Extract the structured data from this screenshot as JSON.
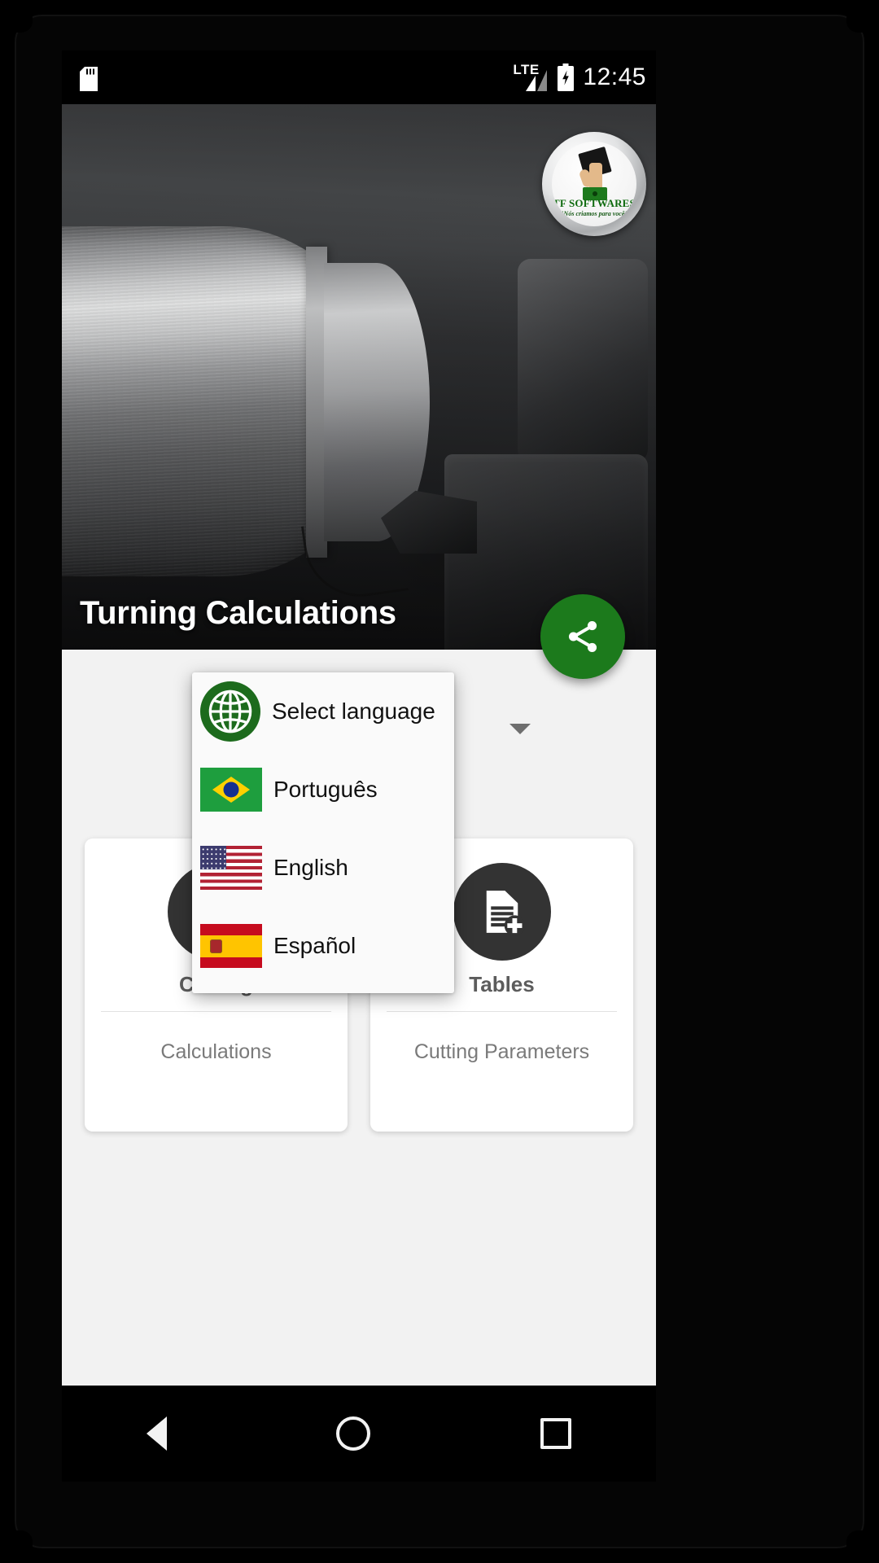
{
  "status_bar": {
    "sd_card_icon": "sd-card-icon",
    "network_label": "LTE",
    "signal_icon": "signal-bars-icon",
    "battery_icon": "battery-charging-icon",
    "clock": "12:45"
  },
  "hero": {
    "title": "Turning Calculations",
    "image_alt": "lathe-turning-photo"
  },
  "app_logo": {
    "name": "TF SOFTWARES",
    "tagline": "\"Nós criamos para você\"",
    "icon": "tf-softwares-logo"
  },
  "fab": {
    "name": "share-button",
    "icon": "share-icon",
    "color": "#1c7a1c"
  },
  "language_spinner": {
    "caret_icon": "chevron-down-icon"
  },
  "language_popup": {
    "items": [
      {
        "label": "Select language",
        "icon": "globe-icon"
      },
      {
        "label": "Português",
        "icon": "flag-brazil-icon"
      },
      {
        "label": "English",
        "icon": "flag-usa-icon"
      },
      {
        "label": "Español",
        "icon": "flag-spain-icon"
      }
    ]
  },
  "cards": [
    {
      "title": "Cutting",
      "subtitle": "Calculations",
      "icon": "calculator-icon"
    },
    {
      "title": "Tables",
      "subtitle": "Cutting Parameters",
      "icon": "document-add-icon"
    }
  ],
  "nav_bar": {
    "back": "back-icon",
    "home": "home-icon",
    "recents": "recents-icon"
  },
  "colors": {
    "accent_green": "#1c7a1c",
    "logo_green": "#0f6b0f",
    "card_bg": "#ffffff",
    "content_bg": "#f2f2f2"
  }
}
